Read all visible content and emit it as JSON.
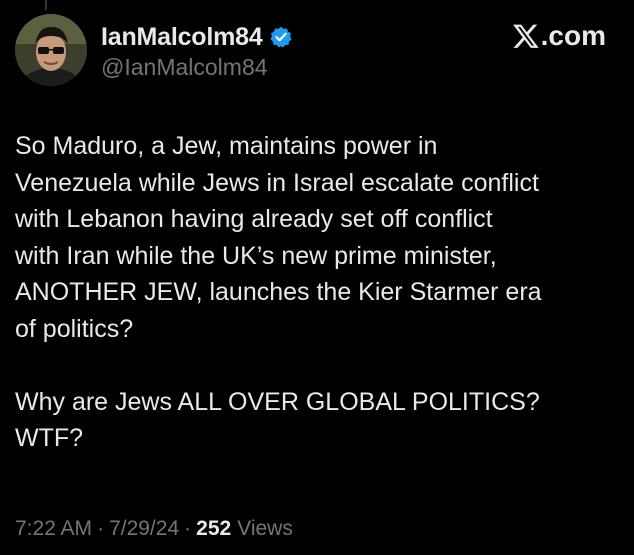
{
  "author": {
    "display_name": "IanMalcolm84",
    "handle": "@IanMalcolm84",
    "verified": true,
    "avatar_icon": "avatar-photo-man-with-glasses"
  },
  "brand": {
    "label": ".com",
    "logo_icon": "x-logo-icon"
  },
  "tweet": {
    "lines": [
      "So Maduro, a Jew, maintains power in",
      "Venezuela while Jews in Israel escalate conflict",
      "with Lebanon having already set off conflict",
      "with Iran while the UK’s new prime minister,",
      "ANOTHER JEW, launches the Kier Starmer era",
      "of politics?",
      "",
      "Why are Jews ALL OVER GLOBAL POLITICS?",
      "WTF?"
    ]
  },
  "meta": {
    "time": "7:22 AM",
    "separator": "·",
    "date": "7/29/24",
    "views_count": "252",
    "views_label": "Views"
  },
  "colors": {
    "background": "#000000",
    "text_primary": "#e7e9ea",
    "text_secondary": "#71767b",
    "verified_blue": "#1d9bf0"
  }
}
